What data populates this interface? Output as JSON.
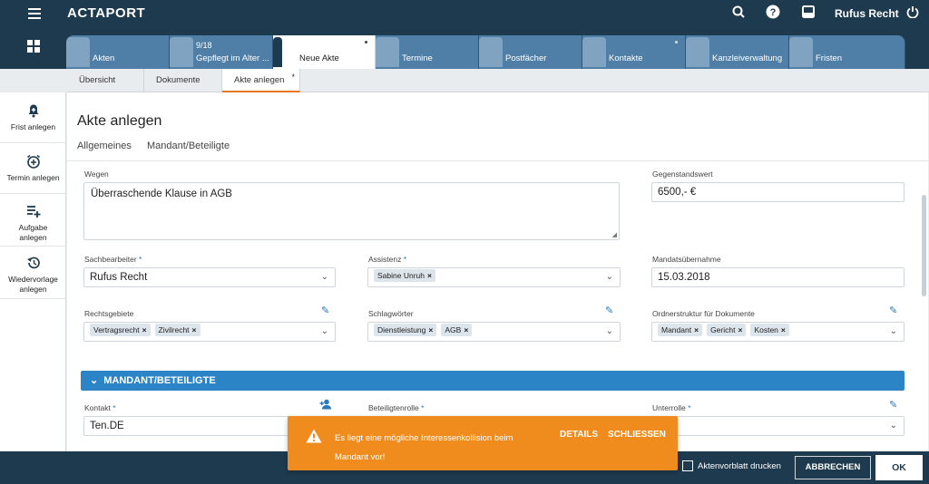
{
  "app": {
    "logo": "ACTAPORT",
    "user_name": "Rufus Recht"
  },
  "icons": {
    "menu": "hamburger-icon",
    "search": "search-icon",
    "help": "help-icon",
    "inbox": "inbox-icon",
    "power": "power-icon",
    "dashboard": "grid-icon"
  },
  "tabs": [
    {
      "label": "Akten",
      "sub": ""
    },
    {
      "label": "Gepflegt im Alter ...",
      "sub": "9/18"
    },
    {
      "label": "Neue Akte",
      "sub": ""
    },
    {
      "label": "Termine",
      "sub": ""
    },
    {
      "label": "Postfächer",
      "sub": ""
    },
    {
      "label": "Kontakte",
      "sub": ""
    },
    {
      "label": "Kanzleiverwaltung",
      "sub": ""
    },
    {
      "label": "Fristen",
      "sub": ""
    }
  ],
  "subtabs": [
    {
      "label": "Übersicht"
    },
    {
      "label": "Dokumente"
    },
    {
      "label": "Akte anlegen",
      "modified": "*"
    }
  ],
  "sidebar": [
    {
      "label": "Frist anlegen",
      "icon": "bell-plus-icon"
    },
    {
      "label": "Termin anlegen",
      "icon": "alarm-plus-icon"
    },
    {
      "label": "Aufgabe anlegen",
      "icon": "list-plus-icon"
    },
    {
      "label": "Wiedervorlage anlegen",
      "icon": "history-icon"
    }
  ],
  "page": {
    "title": "Akte anlegen",
    "sections": [
      "Allgemeines",
      "Mandant/Beteiligte"
    ]
  },
  "form": {
    "wegen": {
      "label": "Wegen",
      "value": "Überraschende Klause in AGB"
    },
    "gegenstandswert": {
      "label": "Gegenstandswert",
      "value": "6500,- €"
    },
    "sachbearbeiter": {
      "label": "Sachbearbeiter",
      "required": "*",
      "value": "Rufus Recht"
    },
    "assistenz": {
      "label": "Assistenz",
      "required": "*",
      "chips": [
        "Sabine Unruh"
      ]
    },
    "mandatsuebernahme": {
      "label": "Mandatsübernahme",
      "value": "15.03.2018"
    },
    "rechtsgebiete": {
      "label": "Rechtsgebiete",
      "chips": [
        "Vertragsrecht",
        "Zivilrecht"
      ]
    },
    "schlagwoerter": {
      "label": "Schlagwörter",
      "chips": [
        "Dienstleistung",
        "AGB"
      ]
    },
    "ordnerstruktur": {
      "label": "Ordnerstruktur für Dokumente",
      "chips": [
        "Mandant",
        "Gericht",
        "Kosten"
      ]
    },
    "mandant_section": {
      "title": "MANDANT/BETEILIGTE"
    },
    "kontakt": {
      "label": "Kontakt",
      "required": "*",
      "value": "Ten.DE"
    },
    "beteiligtenrolle": {
      "label": "Beteiligtenrolle",
      "required": "*"
    },
    "unterrolle": {
      "label": "Unterrolle",
      "required": "*"
    }
  },
  "toast": {
    "message_line1": "Es liegt eine mögliche Interessenkollision beim",
    "message_line2": "Mandant vor!",
    "details_label": "DETAILS",
    "close_label": "SCHLIESSEN"
  },
  "footer": {
    "print_label": "Aktenvorblatt drucken",
    "cancel_label": "ABBRECHEN",
    "ok_label": "OK"
  },
  "colors": {
    "navy": "#1e3a4e",
    "tab_blue": "#4f7fa6",
    "accent_blue": "#2a84c6",
    "toast_orange": "#f08c1e"
  }
}
